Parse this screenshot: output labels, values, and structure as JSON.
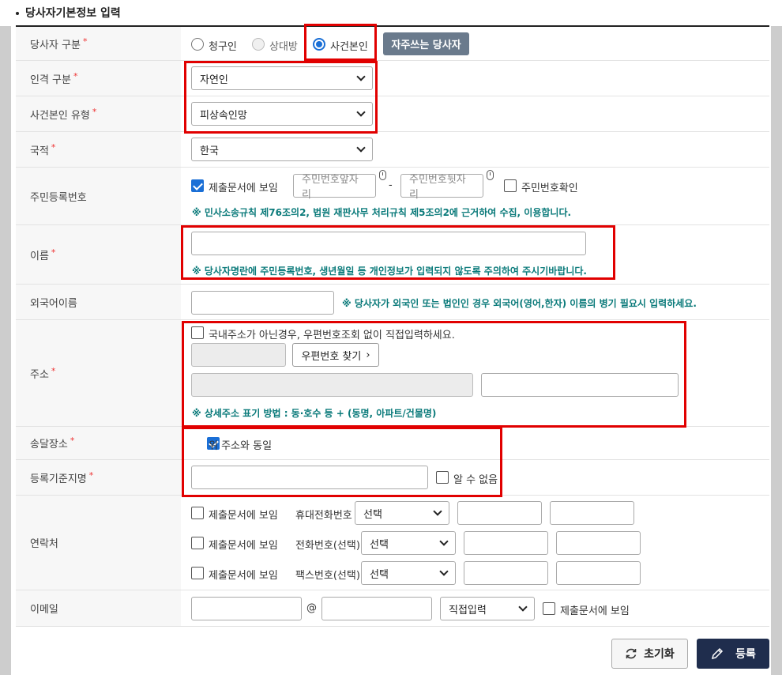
{
  "section_title": "당사자기본정보 입력",
  "rows": {
    "party_type": {
      "label": "당사자 구분",
      "required": "*",
      "options": [
        "청구인",
        "상대방",
        "사건본인"
      ],
      "selected": "사건본인",
      "freq_button": "자주쓰는 당사자"
    },
    "person_type": {
      "label": "인격 구분",
      "required": "*",
      "value": "자연인"
    },
    "subject_type": {
      "label": "사건본인 유형",
      "required": "*",
      "value": "피상속인망"
    },
    "nationality": {
      "label": "국적",
      "required": "*",
      "value": "한국"
    },
    "rrn": {
      "label": "주민등록번호",
      "show_in_docs": "제출문서에 보임",
      "front_placeholder": "주민번호앞자리",
      "dash": "-",
      "back_placeholder": "주민번호뒷자리",
      "confirm_label": "주민번호확인",
      "note": "※ 민사소송규칙 제76조의2, 법원 재판사무 처리규칙 제5조의2에 근거하여 수집, 이용합니다."
    },
    "name": {
      "label": "이름",
      "required": "*",
      "note": "※ 당사자명란에 주민등록번호, 생년월일 등 개인정보가 입력되지 않도록 주의하여 주시기바랍니다."
    },
    "foreign_name": {
      "label": "외국어이름",
      "note": "※ 당사자가 외국인 또는 법인인 경우 외국어(영어,한자) 이름의 병기 필요시 입력하세요."
    },
    "address": {
      "label": "주소",
      "required": "*",
      "overseas_label": "국내주소가 아닌경우, 우편번호조회 없이 직접입력하세요.",
      "postcode_button": "우편번호 찾기",
      "note": "※ 상세주소 표기 방법 : 동·호수 등 + (동명, 아파트/건물명)"
    },
    "delivery": {
      "label": "송달장소",
      "required": "*",
      "same_label": "위 주소와 동일"
    },
    "reg_place": {
      "label": "등록기준지명",
      "required": "*",
      "unknown_label": "알 수 없음"
    },
    "contact": {
      "label": "연락처",
      "lines": [
        {
          "show": "제출문서에 보임",
          "type": "휴대전화번호",
          "select": "선택"
        },
        {
          "show": "제출문서에 보임",
          "type": "전화번호(선택)",
          "select": "선택"
        },
        {
          "show": "제출문서에 보임",
          "type": "팩스번호(선택)",
          "select": "선택"
        }
      ]
    },
    "email": {
      "label": "이메일",
      "at": "@",
      "domain_select": "직접입력",
      "show_in_docs": "제출문서에 보임"
    }
  },
  "footer": {
    "reset_label": "초기화",
    "submit_label": "등록"
  },
  "colors": {
    "highlight": "#e10000",
    "note_text": "#0a7a7a",
    "accent": "#1a6fd6",
    "submit_bg": "#1f2d4d"
  }
}
